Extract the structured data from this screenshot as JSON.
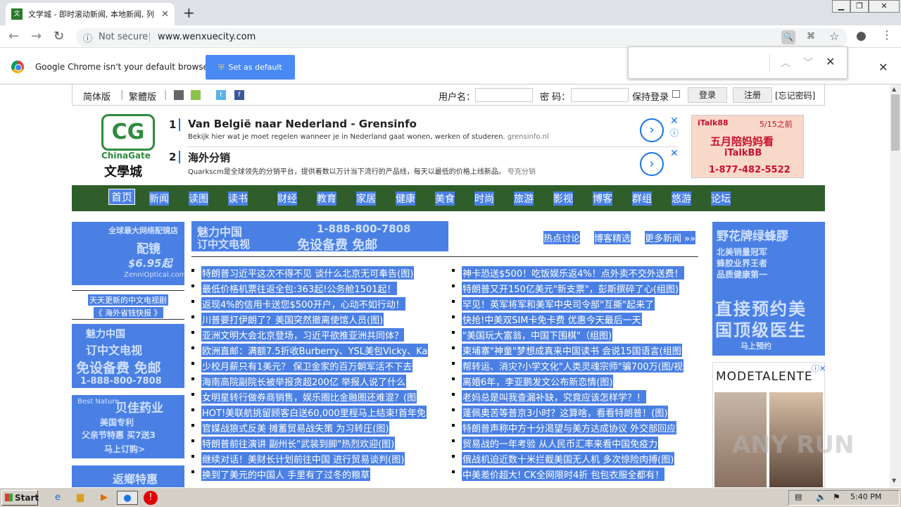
{
  "browser": {
    "tab_title": "文学城 - 即时滚动新闻, 本地新闻, 列",
    "tab_favicon": "文",
    "url_security": "Not secure",
    "url": "www.wenxuecity.com",
    "infobar_text": "Google Chrome isn't your default browser",
    "set_default_label": "Set as default"
  },
  "site": {
    "top_links": [
      "简体版",
      "|",
      "繁體版",
      "|"
    ],
    "username_label": "用户名：",
    "password_label": "密 码：",
    "remember_label": "保持登录",
    "login_label": "登录",
    "register_label": "注册",
    "forgot_label": "[忘记密码]",
    "logo_cg": "CG",
    "logo_name": "ChinaGate",
    "logo_cn": "文學城",
    "ads": [
      {
        "num": "1",
        "headline": "Van België naar Nederland - Grensinfo",
        "desc": "Bekijk hier wat je moet regelen wanneer je in Nederland gaat wonen, werken of studeren.",
        "source": "grensinfo.nl"
      },
      {
        "num": "2",
        "headline": "海外分销",
        "desc": "Quarkscm是全球领先的分销平台，提供着数以万计当下流行的产品线，每天以最低的价格上线新品。",
        "source": "夸克分销"
      }
    ],
    "ad_right": {
      "line1": "iTalk88",
      "date": "5/15之前",
      "line2": "五月陪妈妈看",
      "line3": "iTalkBB",
      "phone": "1-877-482-5522"
    },
    "nav": [
      "首页",
      "新闻",
      "读图",
      "读书",
      "财经",
      "教育",
      "家居",
      "健康",
      "美食",
      "时尚",
      "旅游",
      "影视",
      "博客",
      "群组",
      "悠游",
      "论坛"
    ],
    "left_ad1": {
      "line1": "全球最大网络配镜店",
      "line2": "配镜",
      "price": "$6.95起",
      "site": "ZenniOptical.com"
    },
    "left_text": [
      "天天更新的中文电视剧",
      "《 海外省钱快报 》"
    ],
    "left_ad2": {
      "line1": "魅力中国",
      "line2": "订中文电视",
      "line3": "免设备费 免邮",
      "phone": "1-888-800-7808"
    },
    "left_ad3": {
      "line1": "Best Nature",
      "line2": "贝佳药业",
      "line3": "美国专利",
      "line4": "父亲节特惠 买7送3",
      "line5": "马上订购>"
    },
    "left_ad4": {
      "line1": "返鄉特惠"
    },
    "center_banner": {
      "line1": "魅力中国",
      "phone": "1-888-800-7808",
      "line2": "订中文电视",
      "line3": "免设备费 免邮"
    },
    "center_links": [
      "热点讨论",
      "博客精选",
      "更多新闻 »»"
    ],
    "news_left": [
      "特朗普习近平这次不得不见 谈什么北京无可奉告(图)",
      "最低价格机票往返全包:363起!公务舱1501起！",
      "返现4%的信用卡送您$500开户，心动不如行动！",
      "川普要打伊朗了？美国突然撤离使馆人员(图)",
      "亚洲文明大会北京登场，习近平欲推亚洲共同体？",
      "欧洲直邮：满额7.5折收Burberry、YSL美包Vicky、Ka",
      "少校月薪只有1美元？ 保卫金家的百万朝军活不下去",
      "海南高院副院长被举报贪超200亿 举报人说了什么",
      "女明星转行做券商销售，娱乐圈比金融圈还难混？(图",
      "HOT!美联航挑留顾客白送60,000里程马上结束!首年免",
      "官媒战狼式反美 摊蓄贸易战失策 为习转圧(图)",
      "特朗普前往演讲 副州长\"武装到脚\"热烈欢迎(图)",
      "继续对话！美财长计划前往中国 进行贸易谈判(图)",
      "换到了美元的中国人 手里有了过冬的粮草"
    ],
    "news_right": [
      "神卡恐送$500！吃饭娱乐返4%！点外卖不交外送费！",
      "特朗普又开150亿美元\"新支票\"，彭斯撰碎了心(组图)",
      "罕见！英军将军和美军中央司令部\"互撕\"起来了",
      "快抢!中美双SIM卡免卡费 优惠今天最后一天",
      "\"美国玩大富翁，中国下围棋\"（组图)",
      "柬埔寨\"神童\"梦想成真来中国读书 会说15国语言(组图",
      "帮转运、消灾?小学文化\"人类灵魂宗师\"骗700万(图/视",
      "离婚6年，李亚鹏发文公布新恋情(图)",
      "老妈总是叫我查漏补缺，究竟应该怎样学？！",
      "蓬佩奥苦等普京3小时？这算啥，看看特朗普！(图)",
      "特朗普声称中方十分渴望与美方达成协议 外交部回应",
      "贸易战的一年考验 从人民币汇率来看中国免疫力",
      "俄战机迫近数十米拦截美国无人机 多次惊险肉搏(图)",
      "中美差价超大! CK全网限时4折 包包衣服全都有！"
    ],
    "right_ad1": {
      "line1": "野花牌绿蜂膠",
      "line2": "北美销量冠军",
      "line3": "蜂胶业界王者",
      "line4": "品质健康第一",
      "line5": "直接预约美",
      "line6": "国顶级医生",
      "line7": "马上预约"
    },
    "right_ad2": {
      "brand": "MODETALENTE"
    },
    "watermark": "ANY RUN"
  },
  "taskbar": {
    "start_label": "Start",
    "clock": "5:40 PM"
  }
}
